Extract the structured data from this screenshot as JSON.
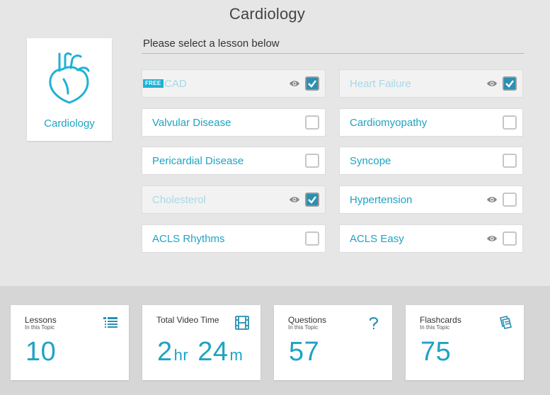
{
  "page": {
    "title": "Cardiology"
  },
  "topic": {
    "label": "Cardiology",
    "icon": "heart-icon"
  },
  "lessons_header": "Please select a lesson below",
  "lessons": [
    {
      "name": "CAD",
      "free_badge": "FREE",
      "viewed": true,
      "checked": true,
      "completed": true
    },
    {
      "name": "Heart Failure",
      "viewed": true,
      "checked": true,
      "completed": true
    },
    {
      "name": "Valvular Disease",
      "viewed": false,
      "checked": false,
      "completed": false
    },
    {
      "name": "Cardiomyopathy",
      "viewed": false,
      "checked": false,
      "completed": false
    },
    {
      "name": "Pericardial Disease",
      "viewed": false,
      "checked": false,
      "completed": false
    },
    {
      "name": "Syncope",
      "viewed": false,
      "checked": false,
      "completed": false
    },
    {
      "name": "Cholesterol",
      "viewed": true,
      "checked": true,
      "completed": true
    },
    {
      "name": "Hypertension",
      "viewed": true,
      "checked": false,
      "completed": false
    },
    {
      "name": "ACLS Rhythms",
      "viewed": false,
      "checked": false,
      "completed": false
    },
    {
      "name": "ACLS Easy",
      "viewed": true,
      "checked": false,
      "completed": false
    }
  ],
  "stats": {
    "lessons": {
      "title": "Lessons",
      "subtitle": "In this Topic",
      "value": "10",
      "icon": "list-icon"
    },
    "video": {
      "title": "Total Video Time",
      "hours": "2",
      "hours_unit": "hr",
      "minutes": "24",
      "minutes_unit": "m",
      "icon": "film-icon"
    },
    "questions": {
      "title": "Questions",
      "subtitle": "In this Topic",
      "value": "57",
      "icon": "question-icon"
    },
    "flashcards": {
      "title": "Flashcards",
      "subtitle": "In this Topic",
      "value": "75",
      "icon": "cards-icon"
    }
  },
  "colors": {
    "accent": "#1fa3c4",
    "checked": "#2a8fb2",
    "background": "#e6e6e6",
    "band": "#d6d6d6"
  }
}
